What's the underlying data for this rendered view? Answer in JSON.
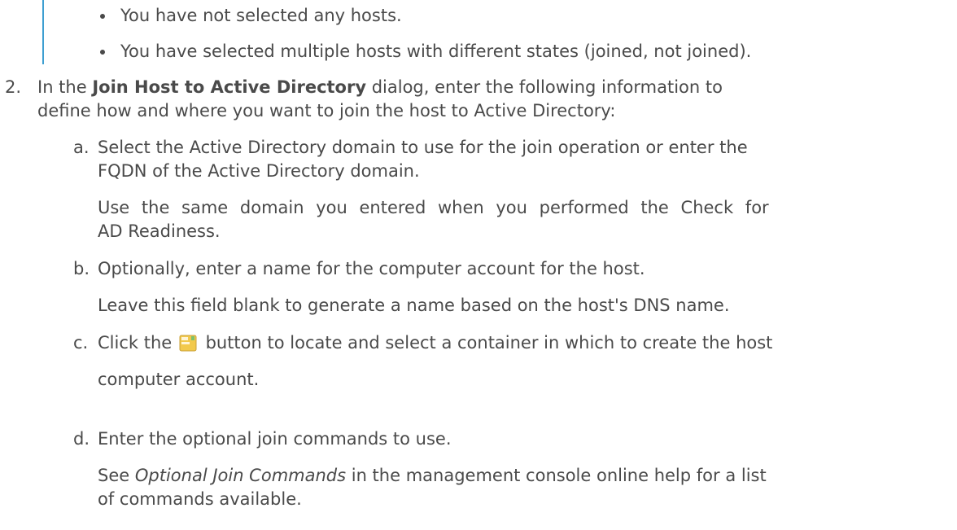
{
  "bullets": [
    "You have not selected any hosts.",
    "You have selected multiple hosts with different states (joined, not joined)."
  ],
  "step2": {
    "number": "2.",
    "prefix": "In the ",
    "dialog_name": "Join Host to Active Directory",
    "suffix_line1": " dialog, enter the following information to",
    "line2": "define how and where you want to join the host to Active Directory:"
  },
  "substeps": {
    "a": {
      "letter": "a.",
      "line1": "Select the Active Directory domain to use for the join operation or enter the",
      "line2": "FQDN of the Active Directory domain.",
      "note_line1": "Use the same domain you entered when you performed the Check for",
      "note_line2": "AD Readiness."
    },
    "b": {
      "letter": "b.",
      "line1": "Optionally, enter a name for the computer account for the host.",
      "note": "Leave this field blank to generate a name based on the host's DNS name."
    },
    "c": {
      "letter": "c.",
      "pre": "Click the",
      "icon": "browse-container-icon",
      "post": "button to locate and select a container in which to create the host",
      "line2": "computer account."
    },
    "d": {
      "letter": "d.",
      "line1": "Enter the optional join commands to use.",
      "note_em": "Optional Join Commands",
      "note_pre": "See ",
      "note_post": " in the management console online help for a list",
      "note_line2": "of commands available."
    }
  },
  "colors": {
    "text": "#4a4a4a",
    "note_bar": "#3d9fd1"
  }
}
